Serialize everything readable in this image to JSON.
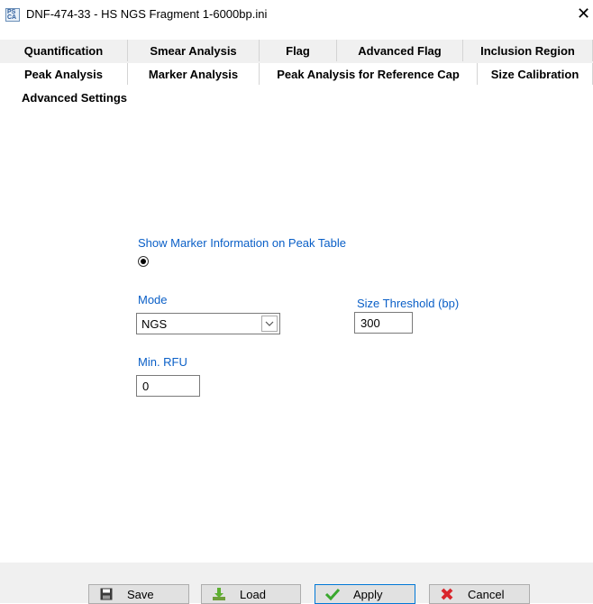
{
  "window": {
    "title": "DNF-474-33 - HS NGS Fragment 1-6000bp.ini",
    "app_icon_top": "PS",
    "app_icon_bottom": "CA"
  },
  "tabs": {
    "row1": [
      "Quantification",
      "Smear Analysis",
      "Flag",
      "Advanced Flag",
      "Inclusion Region"
    ],
    "row2": [
      "Peak Analysis",
      "Marker Analysis",
      "Peak Analysis for Reference Cap",
      "Size Calibration"
    ]
  },
  "panel": {
    "heading": "Advanced Settings",
    "show_marker_label": "Show Marker Information on Peak Table",
    "show_marker_checked": true,
    "mode_label": "Mode",
    "mode_value": "NGS",
    "size_threshold_label": "Size Threshold (bp)",
    "size_threshold_value": "300",
    "min_rfu_label": "Min. RFU",
    "min_rfu_value": "0"
  },
  "buttons": {
    "save": "Save",
    "load": "Load",
    "apply": "Apply",
    "cancel": "Cancel"
  },
  "colors": {
    "label_blue": "#0a5fc7",
    "tab_bg": "#f0f0f0",
    "button_bg": "#e1e1e1",
    "primary_border": "#0078d7"
  }
}
